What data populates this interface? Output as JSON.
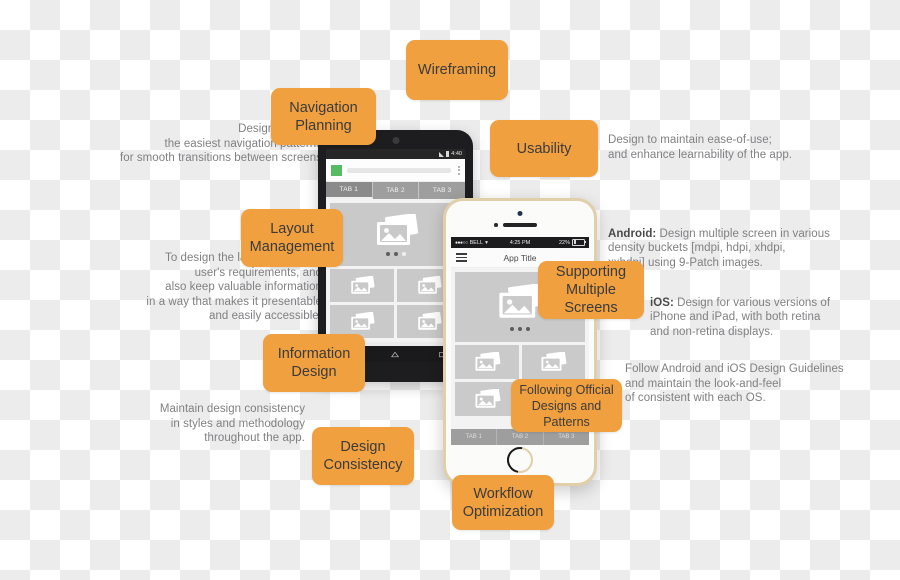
{
  "infographic": {
    "badges": [
      {
        "id": "wireframing",
        "label": "Wireframing"
      },
      {
        "id": "navigation-planning",
        "label": "Navigation\nPlanning"
      },
      {
        "id": "usability",
        "label": "Usability"
      },
      {
        "id": "layout-management",
        "label": "Layout\nManagement"
      },
      {
        "id": "information-design",
        "label": "Information\nDesign"
      },
      {
        "id": "supporting-multiple-screens",
        "label": "Supporting\nMultiple Screens"
      },
      {
        "id": "design-consistency",
        "label": "Design\nConsistency"
      },
      {
        "id": "following-official-designs",
        "label": "Following Official\nDesigns and Patterns"
      },
      {
        "id": "workflow-optimization",
        "label": "Workflow\nOptimization"
      }
    ],
    "captions": {
      "navigation_planning": "Design and plan\nthe easiest navigation patterns\nfor smooth transitions between screens",
      "layout_management": "To design the layout to suit the\nuser's requirements, and\nalso keep valuable information\nin a way that makes it presentable\nand easily accessible.",
      "design_consistency": "Maintain design consistency\nin styles and methodology\nthroughout the app.",
      "usability": "Design to maintain ease-of-use;\nand enhance learnability of the app.",
      "android_label": "Android:",
      "android_text": " Design multiple screen in various\ndensity buckets [mdpi, hdpi, xhdpi,\nxxhdpi] using 9-Patch images.",
      "ios_label": "iOS:",
      "ios_text": " Design for various versions of\niPhone and iPad, with both retina\nand non-retina displays.",
      "guidelines": "Follow Android and iOS Design Guidelines\nand maintain the look-and-feel\nof consistent with each OS."
    },
    "colors": {
      "badge_orange": "#f0a03e",
      "badge_text": "#3b3b3d",
      "caption_gray": "#808083",
      "android_green": "#57bb63"
    }
  },
  "android_mockup": {
    "status_time": "4:40",
    "tabs": [
      "TAB 1",
      "TAB 2",
      "TAB 3"
    ],
    "active_tab": "TAB 1"
  },
  "iphone_mockup": {
    "carrier": "BELL",
    "status_time": "4:25 PM",
    "battery": "22%",
    "title": "App Title",
    "tabs": [
      "TAB 1",
      "TAB 2",
      "TAB 3"
    ]
  }
}
